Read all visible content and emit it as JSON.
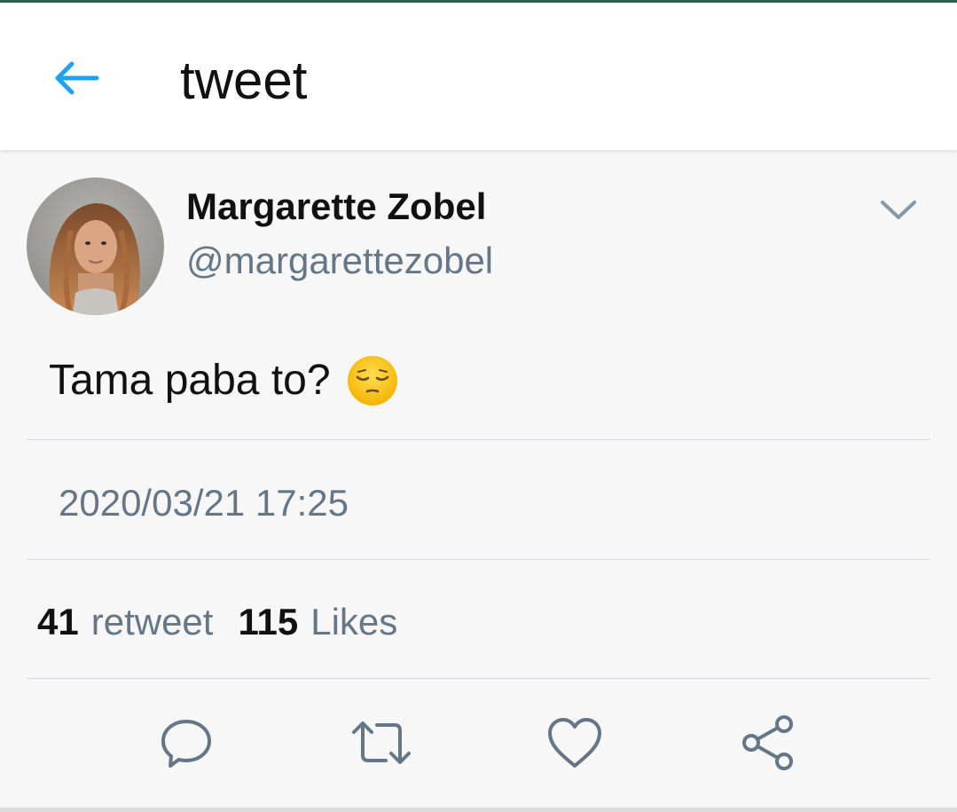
{
  "header": {
    "title": "tweet",
    "back_icon": "back-arrow-icon",
    "accent_color": "#1da1f2"
  },
  "tweet": {
    "display_name": "Margarette Zobel",
    "handle": "@margarettezobel",
    "text": "Tama paba to?",
    "emoji": "pensive-face-emoji",
    "timestamp": "2020/03/21 17:25"
  },
  "stats": {
    "retweet_count": "41",
    "retweet_label": "retweet",
    "likes_count": "115",
    "likes_label": "Likes"
  },
  "actions": [
    {
      "icon": "reply-icon"
    },
    {
      "icon": "retweet-icon"
    },
    {
      "icon": "like-icon"
    },
    {
      "icon": "share-icon"
    }
  ],
  "colors": {
    "secondary_text": "#657786",
    "icon_gray": "#657786",
    "background": "#f7f7f7"
  }
}
